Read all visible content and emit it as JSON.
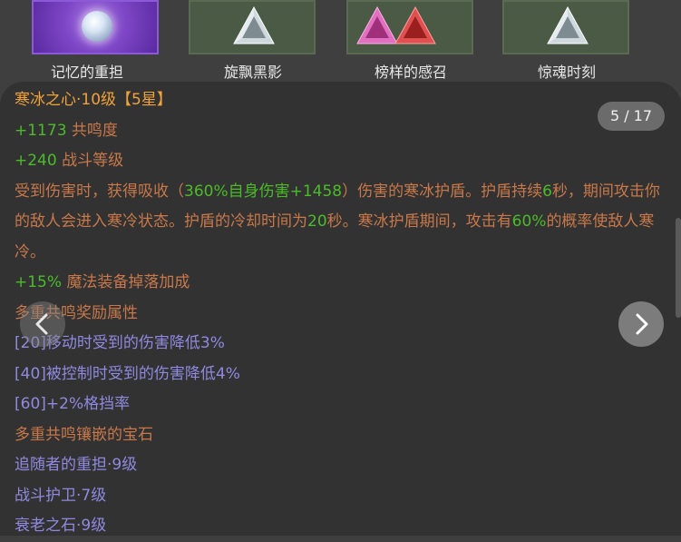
{
  "gems": [
    {
      "label": "记忆的重担",
      "icon": "frost-orb-icon",
      "selected": true
    },
    {
      "label": "旋飘黑影",
      "icon": "silver-triangle-gem-icon"
    },
    {
      "label": "榜样的感召",
      "icon": "pink-red-triangle-gems-icon"
    },
    {
      "label": "惊魂时刻",
      "icon": "silver-triangle-gem-icon"
    }
  ],
  "pager": {
    "text": "5 / 17",
    "current": 5,
    "total": 17
  },
  "detail": {
    "title": "寒冰之心·10级【5星】",
    "stats": [
      {
        "value": "+1173",
        "name": "共鸣度"
      },
      {
        "value": "+240",
        "name": "战斗等级"
      }
    ],
    "effect": {
      "p1": "受到伤害时，获得吸收（",
      "v1": "360%自身伤害+1458",
      "p2": "）伤害的寒冰护盾。护盾持续",
      "v2": "6",
      "p3": "秒，期间攻击你的敌人会进入寒冷状态。护盾的冷却时间为",
      "v3": "20",
      "p4": "秒。寒冰护盾期间，攻击有",
      "v4": "60%",
      "p5": "的概率使敌人寒冷。"
    },
    "bonus": {
      "value": "+15%",
      "name": "魔法装备掉落加成"
    },
    "resonance_header": "多重共鸣奖励属性",
    "resonance_bonuses": [
      "[20]移动时受到的伤害降低3%",
      "[40]被控制时受到的伤害降低4%",
      "[60]+2%格挡率"
    ],
    "socketed_header": "多重共鸣镶嵌的宝石",
    "socketed_gems": [
      "追随者的重担·9级",
      "战斗护卫·7级",
      "衰老之石·9级"
    ]
  },
  "colors": {
    "title": "#f2a23a",
    "green": "#4cbb2a",
    "text_orange": "#c8784a",
    "blue": "#8f8ae0",
    "panel_bg": "#323232"
  },
  "nav": {
    "prev_icon": "chevron-left-icon",
    "next_icon": "chevron-right-icon"
  }
}
